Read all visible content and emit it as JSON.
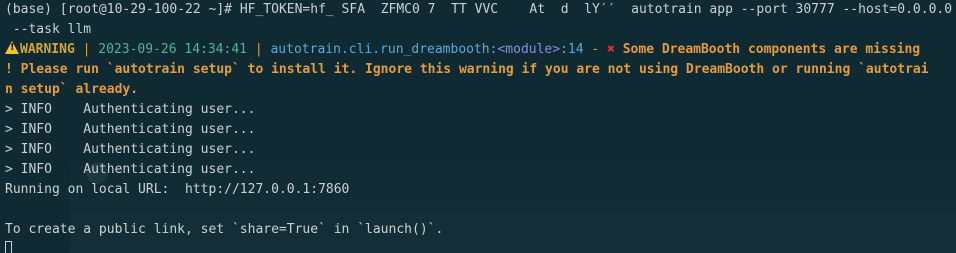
{
  "terminal": {
    "prompt": "(base) [root@10-29-100-22 ~]# ",
    "command_part1": "HF_TOKEN=hf_ SFA  ZFMC0 7  TT VVC    At  d  lY′′  ",
    "command_part2": "autotrain app --port 30777 --host=0.0.0.0",
    "command_cont": " --task llm",
    "warning": {
      "level": "WARNING",
      "separator1": " | ",
      "timestamp": "2023-09-26 14:34:41",
      "separator2": " | ",
      "module_path": "autotrain.cli.run_dreambooth",
      "module_colon": ":",
      "module_tag": "<module>",
      "line_suffix": ":14",
      "dash": " - ",
      "message_line1": "Some DreamBooth components are missing",
      "message_line2": "! Please run `autotrain setup` to install it. Ignore this warning if you are not using DreamBooth or running `autotrai",
      "message_line3": "n setup` already."
    },
    "info_lines": [
      "> INFO    Authenticating user...",
      "> INFO    Authenticating user...",
      "> INFO    Authenticating user...",
      "> INFO    Authenticating user..."
    ],
    "running_line": "Running on local URL:  http://127.0.0.1:7860",
    "public_link_line": "To create a public link, set `share=True` in `launch()`."
  },
  "colors": {
    "background": "#102a33",
    "text": "#c9d1d4",
    "warning": "#d4a434",
    "timestamp": "#4fb39a",
    "module": "#5fa8d6",
    "error_mark": "#e0302c",
    "message": "#e39b3c"
  },
  "icons": {
    "warning": "warning-triangle-icon",
    "error": "red-x-icon",
    "cursor": "block-cursor"
  }
}
